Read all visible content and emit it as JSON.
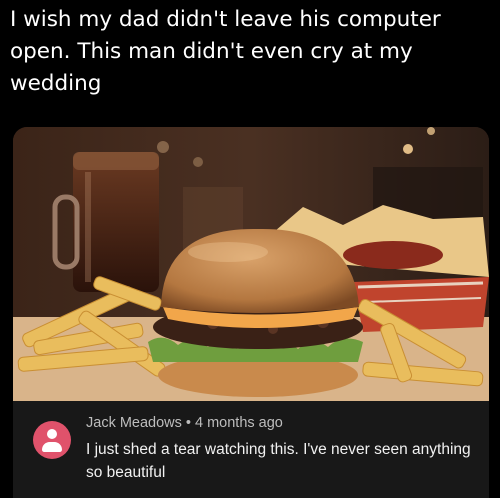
{
  "post": {
    "caption": "I wish my dad didn't leave his computer open. This man didn't even cry at my wedding"
  },
  "photo": {
    "subject": "burger-with-fries-and-soda"
  },
  "comment": {
    "author": "Jack Meadows",
    "separator": "•",
    "time": "4 months ago",
    "text": "I just shed a tear watching this. I've never seen anything so beautiful",
    "avatar_color": "#e0526b"
  }
}
